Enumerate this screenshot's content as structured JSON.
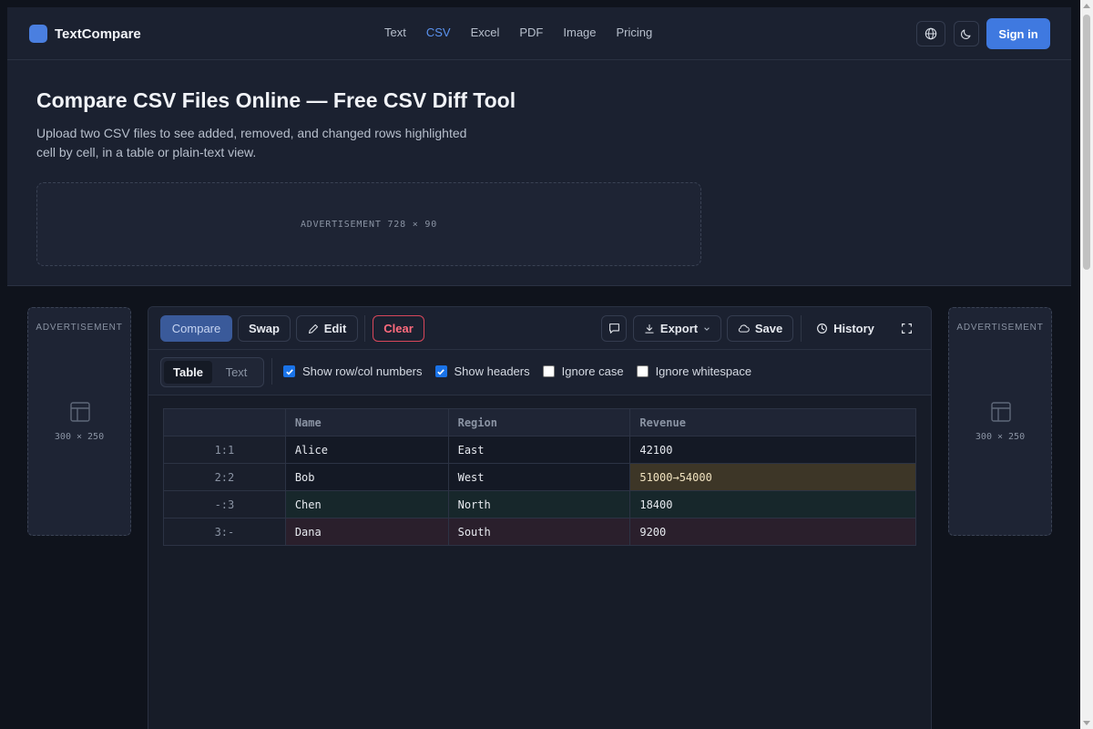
{
  "brand": {
    "name": "TextCompare",
    "accent": "#4a7fe0"
  },
  "nav": {
    "links": [
      "Text",
      "CSV",
      "Excel",
      "PDF",
      "Image",
      "Pricing"
    ],
    "active": "CSV",
    "language_icon": "globe-icon",
    "theme_icon": "moon-icon",
    "signin_label": "Sign in"
  },
  "hero": {
    "title": "Compare CSV Files Online — Free CSV Diff Tool",
    "description": "Upload two CSV files to see added, removed, and changed rows highlighted cell by cell, in a table or plain-text view."
  },
  "ads": {
    "banner_label": "ADVERTISEMENT  728 × 90",
    "side_title": "ADVERTISEMENT",
    "side_size": "300 × 250"
  },
  "toolbar": {
    "compare_label": "Compare",
    "swap_label": "Swap",
    "edit_label": "Edit",
    "clear_label": "Clear",
    "comment_icon": "comment-icon",
    "export_label": "Export",
    "save_label": "Save",
    "history_label": "History",
    "fullscreen_icon": "fullscreen-icon"
  },
  "view": {
    "modes": [
      "Table",
      "Text"
    ],
    "active_mode": "Table",
    "options": [
      {
        "label": "Show row/col numbers",
        "checked": true
      },
      {
        "label": "Show headers",
        "checked": true
      },
      {
        "label": "Ignore case",
        "checked": false
      },
      {
        "label": "Ignore whitespace",
        "checked": false
      }
    ]
  },
  "table": {
    "headers": [
      "",
      "Name",
      "Region",
      "Revenue"
    ],
    "rows": [
      {
        "num": "1:1",
        "status": "same",
        "cells": [
          "Alice",
          "East",
          "42100"
        ]
      },
      {
        "num": "2:2",
        "status": "changed",
        "cells": [
          "Bob",
          "West",
          "51000→54000"
        ],
        "changed_col": 2
      },
      {
        "num": "-:3",
        "status": "added",
        "cells": [
          "Chen",
          "North",
          "18400"
        ]
      },
      {
        "num": "3:-",
        "status": "removed",
        "cells": [
          "Dana",
          "South",
          "9200"
        ]
      }
    ]
  },
  "colors": {
    "added": "#17272b",
    "removed": "#2a1f2c",
    "changed": "#3d3627",
    "primary": "#3f79e0",
    "danger": "#d8475b"
  }
}
